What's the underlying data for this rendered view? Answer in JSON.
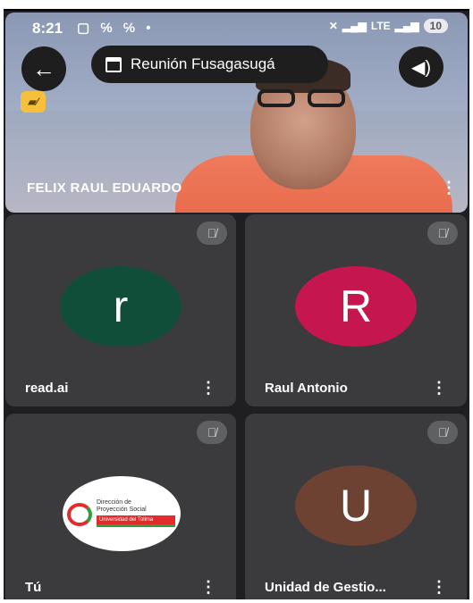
{
  "status_bar": {
    "time": "8:21",
    "notification_icons": "▢ ℅ ℅ •",
    "signal_text": "LTE",
    "battery": "10"
  },
  "header": {
    "meeting_title": "Reunión Fusagasugá"
  },
  "main_participant": {
    "name": "FELIX RAUL EDUARDO"
  },
  "participants": [
    {
      "name": "read.ai",
      "avatar_letter": "r",
      "avatar_color": "#104e3a"
    },
    {
      "name": "Raul Antonio",
      "avatar_letter": "R",
      "avatar_color": "#c6164f"
    },
    {
      "name": "Tú",
      "logo_lines": [
        "Dirección de",
        "Proyección Social",
        "Universidad del Tolima"
      ]
    },
    {
      "name": "Unidad de Gestio...",
      "avatar_letter": "U",
      "avatar_color": "#6d4232"
    }
  ]
}
